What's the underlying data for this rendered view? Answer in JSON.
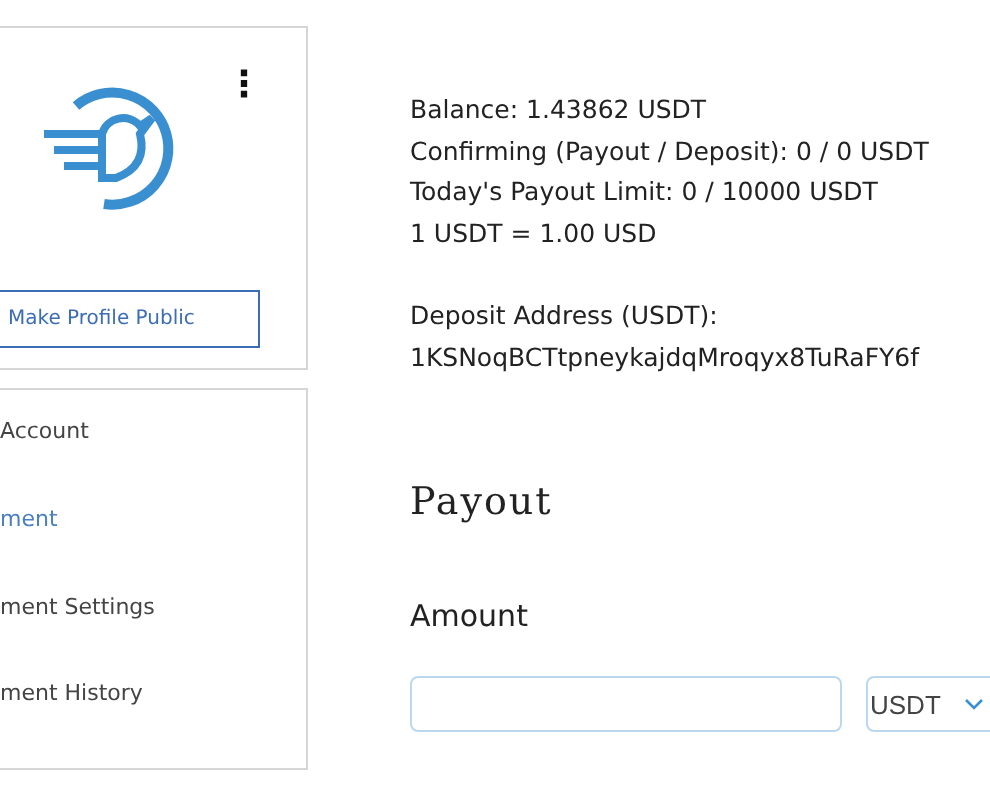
{
  "profile": {
    "menu_icon": "⋮",
    "button": "Make Profile Public"
  },
  "nav": {
    "items": [
      {
        "label": "Account",
        "selected": false
      },
      {
        "label": "ment",
        "selected": true
      },
      {
        "label": "ment Settings",
        "selected": false
      },
      {
        "label": "ment History",
        "selected": false
      }
    ]
  },
  "info": {
    "lines": [
      "Balance: 1.43862 USDT",
      "Confirming (Payout / Deposit): 0 / 0 USDT",
      "Today's Payout Limit: 0 / 10000 USDT",
      "1 USDT = 1.00 USD"
    ],
    "deposit_label": "Deposit Address (USDT):",
    "deposit_address": "1KSNoqBCTtpneykajdqMroqyx8TuRaFY6f"
  },
  "payout": {
    "title": "Payout",
    "amount_label": "Amount",
    "currency": "USDT"
  }
}
